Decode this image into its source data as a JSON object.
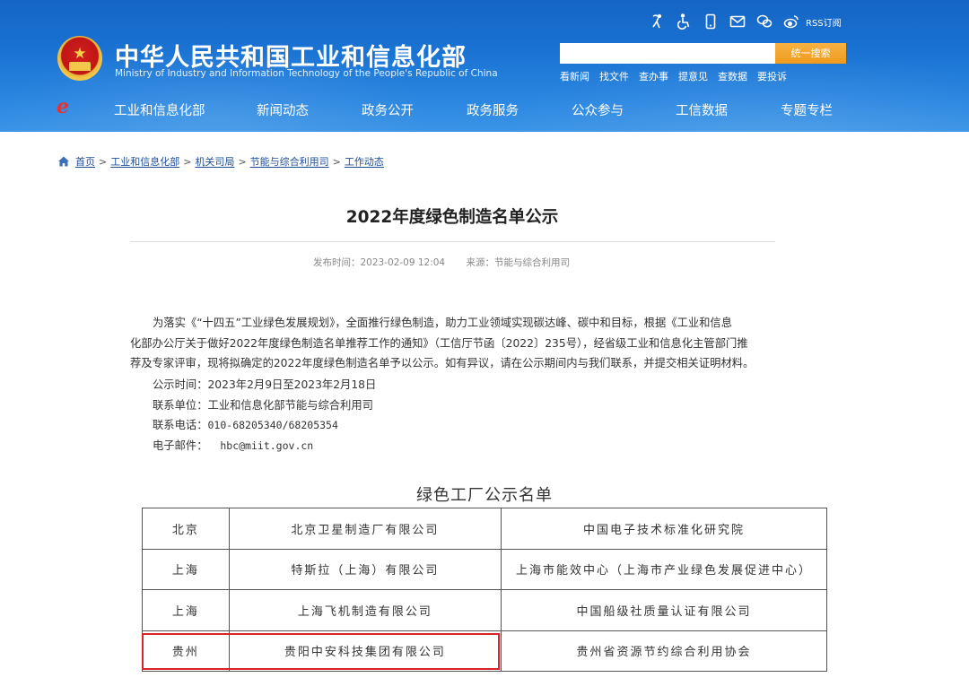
{
  "header": {
    "title": "中华人民共和国工业和信息化部",
    "subtitle": "Ministry of Industry and Information Technology of the People's Republic of China",
    "rss_label": "RSS订阅",
    "icons": [
      "accessibility-cane-icon",
      "wheelchair-icon",
      "mobile-icon",
      "mail-icon",
      "wechat-icon",
      "weibo-icon"
    ],
    "search": {
      "placeholder": "",
      "button_label": "统一搜索"
    },
    "quick_links": [
      "看新闻",
      "找文件",
      "查办事",
      "提意见",
      "查数据",
      "要投诉"
    ],
    "nav": [
      "工业和信息化部",
      "新闻动态",
      "政务公开",
      "政务服务",
      "公众参与",
      "工信数据",
      "专题专栏"
    ],
    "colors": {
      "header_blue": "#1a73d3",
      "search_orange": "#ee9a1c",
      "highlight_red": "#d8232a"
    }
  },
  "breadcrumb": [
    "首页",
    "工业和信息化部",
    "机关司局",
    "节能与综合利用司",
    "工作动态"
  ],
  "article": {
    "title": "2022年度绿色制造名单公示",
    "publish_time": "发布时间：2023-02-09 12:04",
    "source": "来源：节能与综合利用司",
    "para_lines": [
      "为落实《“十四五”工业绿色发展规划》，全面推行绿色制造，助力工业领域实现碳达峰、碳中和目标，根据《工业和信息",
      "化部办公厅关于做好2022年度绿色制造名单推荐工作的通知》（工信厅节函〔2022〕235号），经省级工业和信息化主管部门推",
      "荐及专家评审，现将拟确定的2022年度绿色制造名单予以公示。如有异议，请在公示期间内与我们联系，并提交相关证明材料。"
    ],
    "notice_period": "公示时间：2023年2月9日至2023年2月18日",
    "contact_unit": "联系单位：工业和信息化部节能与综合利用司",
    "phone_label": "联系电话：",
    "phone": "010-68205340/68205354",
    "email_label": "电子邮件：",
    "email": "hbc@miit.gov.cn"
  },
  "table": {
    "title": "绿色工厂公示名单",
    "rows": [
      [
        "北京",
        "北京卫星制造厂有限公司",
        "中国电子技术标准化研究院"
      ],
      [
        "上海",
        "特斯拉（上海）有限公司",
        "上海市能效中心（上海市产业绿色发展促进中心）"
      ],
      [
        "上海",
        "上海飞机制造有限公司",
        "中国船级社质量认证有限公司"
      ],
      [
        "贵州",
        "贵阳中安科技集团有限公司",
        "贵州省资源节约综合利用协会"
      ]
    ]
  }
}
